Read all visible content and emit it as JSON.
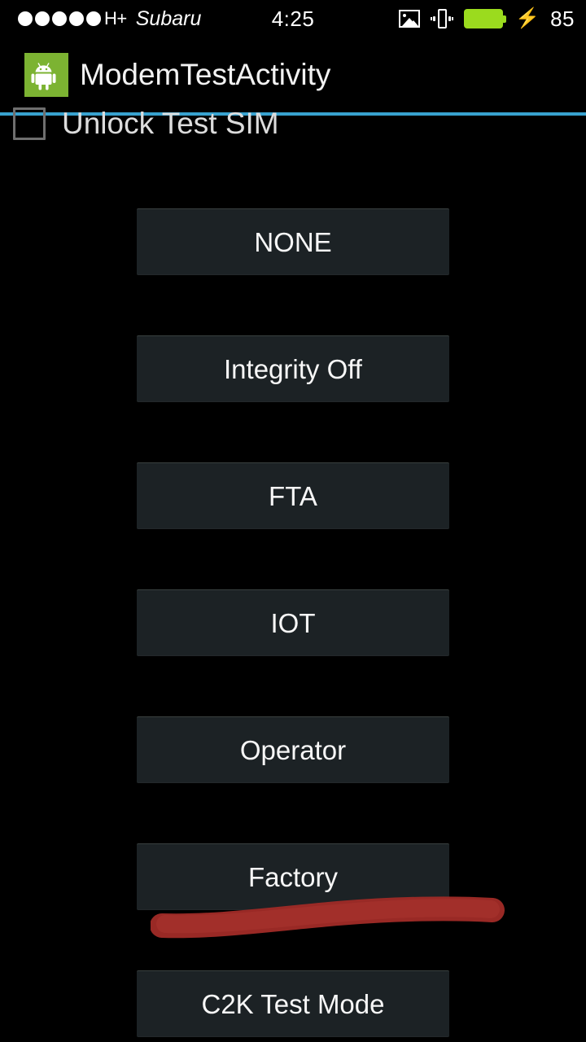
{
  "status_bar": {
    "signal_dots": 5,
    "network_type": "H+",
    "carrier": "Subaru",
    "time": "4:25",
    "icons": [
      "image-icon",
      "vibrate-icon",
      "battery-icon",
      "charging-bolt-icon"
    ],
    "battery_percent": "85",
    "charging_bolt": "⚡",
    "battery_color": "#9bdb1e"
  },
  "title_bar": {
    "app_icon": "android-robot-icon",
    "title": "ModemTestActivity",
    "accent_color": "#38a2cf",
    "icon_bg_color": "#7cb332"
  },
  "content": {
    "checkbox": {
      "label": "Unlock Test SIM",
      "checked": false
    },
    "buttons": [
      {
        "label": "NONE"
      },
      {
        "label": "Integrity Off"
      },
      {
        "label": "FTA"
      },
      {
        "label": "IOT"
      },
      {
        "label": "Operator"
      },
      {
        "label": "Factory"
      },
      {
        "label": "C2K Test Mode"
      }
    ]
  },
  "annotation": {
    "type": "handdrawn-underline",
    "color": "#9e2a26",
    "targets": "Factory"
  }
}
